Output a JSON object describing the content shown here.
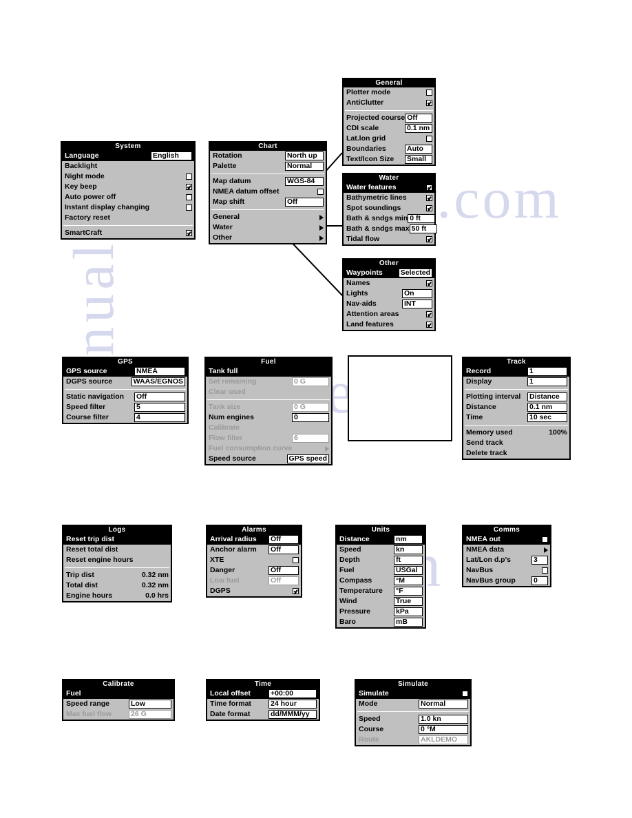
{
  "watermark": {
    "a": "w.com",
    "b": "anualslib",
    "c": "ve.c",
    "d": "sh"
  },
  "panels": {
    "system": {
      "title": "System",
      "rows": [
        {
          "label": "Language",
          "value": "English",
          "type": "box",
          "selected": true
        },
        {
          "label": "Backlight",
          "type": "none"
        },
        {
          "label": "Night mode",
          "type": "check",
          "checked": false
        },
        {
          "label": "Key beep",
          "type": "check",
          "checked": true
        },
        {
          "label": "Auto power off",
          "type": "check",
          "checked": false
        },
        {
          "label": "Instant display changing",
          "type": "check",
          "checked": false
        },
        {
          "label": "Factory reset",
          "type": "none"
        },
        {
          "type": "gap"
        },
        {
          "label": "SmartCraft",
          "type": "check",
          "checked": true
        }
      ]
    },
    "chart": {
      "title": "Chart",
      "rows": [
        {
          "label": "Rotation",
          "value": "North up",
          "type": "box"
        },
        {
          "label": "Palette",
          "value": "Normal",
          "type": "box"
        },
        {
          "type": "gap"
        },
        {
          "label": "Map datum",
          "value": "WGS-84",
          "type": "box"
        },
        {
          "label": "NMEA datum offset",
          "type": "check",
          "checked": false
        },
        {
          "label": "Map shift",
          "value": "Off",
          "type": "box"
        },
        {
          "type": "gap"
        },
        {
          "label": "General",
          "type": "arrow"
        },
        {
          "label": "Water",
          "type": "arrow"
        },
        {
          "label": "Other",
          "type": "arrow"
        }
      ]
    },
    "general": {
      "title": "General",
      "rows": [
        {
          "label": "Plotter mode",
          "type": "check",
          "checked": false
        },
        {
          "label": "AntiClutter",
          "type": "check",
          "checked": true
        },
        {
          "type": "gap"
        },
        {
          "label": "Projected course",
          "value": "Off",
          "type": "box"
        },
        {
          "label": "CDI scale",
          "value": "0.1  nm",
          "type": "box"
        },
        {
          "label": "Lat.lon grid",
          "type": "check",
          "checked": false
        },
        {
          "label": "Boundaries",
          "value": "Auto",
          "type": "box"
        },
        {
          "label": "Text/Icon Size",
          "value": "Small",
          "type": "box"
        }
      ]
    },
    "water": {
      "title": "Water",
      "rows": [
        {
          "label": "Water features",
          "type": "check",
          "checked": true,
          "selected": true
        },
        {
          "label": "Bathymetric lines",
          "type": "check",
          "checked": true
        },
        {
          "label": "Spot soundings",
          "type": "check",
          "checked": true
        },
        {
          "label": "Bath & sndgs min",
          "value": "0 ft",
          "type": "box"
        },
        {
          "label": "Bath & sndgs max",
          "value": "50 ft",
          "type": "box"
        },
        {
          "label": "Tidal flow",
          "type": "check",
          "checked": true
        }
      ]
    },
    "other": {
      "title": "Other",
      "rows": [
        {
          "label": "Waypoints",
          "value": "Selected",
          "type": "box",
          "selected": true
        },
        {
          "label": "Names",
          "type": "check",
          "checked": true
        },
        {
          "label": "Lights",
          "value": "On",
          "type": "box"
        },
        {
          "label": "Nav-aids",
          "value": "INT",
          "type": "box"
        },
        {
          "label": "Attention areas",
          "type": "check",
          "checked": true
        },
        {
          "label": "Land features",
          "type": "check",
          "checked": true
        }
      ]
    },
    "gps": {
      "title": "GPS",
      "rows": [
        {
          "label": "GPS source",
          "value": "NMEA",
          "type": "box",
          "selected": true
        },
        {
          "label": "DGPS source",
          "value": "WAAS/EGNOS",
          "type": "box"
        },
        {
          "type": "gap"
        },
        {
          "label": "Static navigation",
          "value": "Off",
          "type": "box"
        },
        {
          "label": "Speed filter",
          "value": "5",
          "type": "box"
        },
        {
          "label": "Course filter",
          "value": "4",
          "type": "box"
        }
      ]
    },
    "fuel": {
      "title": "Fuel",
      "rows": [
        {
          "label": "Tank full",
          "type": "none",
          "selected": true
        },
        {
          "label": "Set remaining",
          "value": "0 G",
          "type": "box",
          "disabled": true
        },
        {
          "label": "Clear used",
          "type": "none",
          "disabled": true
        },
        {
          "type": "gap"
        },
        {
          "label": "Tank size",
          "value": "0 G",
          "type": "box",
          "disabled": true
        },
        {
          "label": "Num engines",
          "value": "0",
          "type": "box"
        },
        {
          "label": "Calibrate",
          "type": "none",
          "disabled": true
        },
        {
          "label": "Flow filter",
          "value": "6",
          "type": "box",
          "disabled": true
        },
        {
          "label": "Fuel consumption curve",
          "type": "arrow",
          "disabled": true
        },
        {
          "label": "Speed source",
          "value": "GPS speed",
          "type": "box"
        }
      ]
    },
    "track": {
      "title": "Track",
      "rows": [
        {
          "label": "Record",
          "value": "1",
          "type": "box",
          "selected": true
        },
        {
          "label": "Display",
          "value": "1",
          "type": "box"
        },
        {
          "type": "gap"
        },
        {
          "label": "Plotting interval",
          "value": "Distance",
          "type": "box"
        },
        {
          "label": "Distance",
          "value": "0.1 nm",
          "type": "box"
        },
        {
          "label": "Time",
          "value": "10 sec",
          "type": "box"
        },
        {
          "type": "gap"
        },
        {
          "label": "Memory used",
          "value": "100%",
          "type": "plain"
        },
        {
          "label": "Send track",
          "type": "none"
        },
        {
          "label": "Delete track",
          "type": "none"
        }
      ]
    },
    "logs": {
      "title": "Logs",
      "rows": [
        {
          "label": "Reset trip dist",
          "type": "none",
          "selected": true
        },
        {
          "label": "Reset total dist",
          "type": "none"
        },
        {
          "label": "Reset engine hours",
          "type": "none"
        },
        {
          "type": "gap"
        },
        {
          "label": "Trip dist",
          "value": "0.32 nm",
          "type": "plain"
        },
        {
          "label": "Total dist",
          "value": "0.32 nm",
          "type": "plain"
        },
        {
          "label": "Engine hours",
          "value": "0.0 hrs",
          "type": "plain"
        }
      ]
    },
    "alarms": {
      "title": "Alarms",
      "rows": [
        {
          "label": "Arrival radius",
          "value": "Off",
          "type": "box",
          "selected": true
        },
        {
          "label": "Anchor alarm",
          "value": "Off",
          "type": "box"
        },
        {
          "label": "XTE",
          "type": "check",
          "checked": false
        },
        {
          "label": "Danger",
          "value": "Off",
          "type": "box"
        },
        {
          "label": "Low fuel",
          "value": "Off",
          "type": "box",
          "disabled": true
        },
        {
          "label": "DGPS",
          "type": "check",
          "checked": true
        }
      ]
    },
    "units": {
      "title": "Units",
      "rows": [
        {
          "label": "Distance",
          "value": "nm",
          "type": "box",
          "selected": true
        },
        {
          "label": "Speed",
          "value": "kn",
          "type": "box"
        },
        {
          "label": "Depth",
          "value": "ft",
          "type": "box"
        },
        {
          "label": "Fuel",
          "value": "USGal",
          "type": "box"
        },
        {
          "label": "Compass",
          "value": "°M",
          "type": "box"
        },
        {
          "label": "Temperature",
          "value": "°F",
          "type": "box"
        },
        {
          "label": "Wind",
          "value": "True",
          "type": "box"
        },
        {
          "label": "Pressure",
          "value": "kPa",
          "type": "box"
        },
        {
          "label": "Baro",
          "value": "mB",
          "type": "box"
        }
      ]
    },
    "comms": {
      "title": "Comms",
      "rows": [
        {
          "label": "NMEA out",
          "type": "check",
          "checked": false,
          "selected": true
        },
        {
          "label": "NMEA data",
          "type": "arrow"
        },
        {
          "label": "Lat/Lon d.p's",
          "value": "3",
          "type": "box"
        },
        {
          "label": "NavBus",
          "type": "check",
          "checked": false
        },
        {
          "label": "NavBus group",
          "value": "0",
          "type": "box"
        }
      ]
    },
    "calibrate": {
      "title": "Calibrate",
      "rows": [
        {
          "label": "Fuel",
          "type": "none",
          "selected": true
        },
        {
          "label": "Speed range",
          "value": "Low",
          "type": "box"
        },
        {
          "label": "Max fuel flow",
          "value": "26 G",
          "type": "box",
          "disabled": true
        }
      ]
    },
    "time": {
      "title": "Time",
      "rows": [
        {
          "label": "Local offset",
          "value": "+00:00",
          "type": "box",
          "selected": true
        },
        {
          "label": "Time format",
          "value": "24 hour",
          "type": "box"
        },
        {
          "label": "Date format",
          "value": "dd/MMM/yy",
          "type": "box"
        }
      ]
    },
    "simulate": {
      "title": "Simulate",
      "rows": [
        {
          "label": "Simulate",
          "type": "check",
          "checked": false,
          "selected": true
        },
        {
          "label": "Mode",
          "value": "Normal",
          "type": "box"
        },
        {
          "type": "gap"
        },
        {
          "label": "Speed",
          "value": "1.0 kn",
          "type": "box"
        },
        {
          "label": "Course",
          "value": "0 °M",
          "type": "box"
        },
        {
          "label": "Route",
          "value": "AKLDEMO",
          "type": "box",
          "disabled": true
        }
      ]
    }
  }
}
